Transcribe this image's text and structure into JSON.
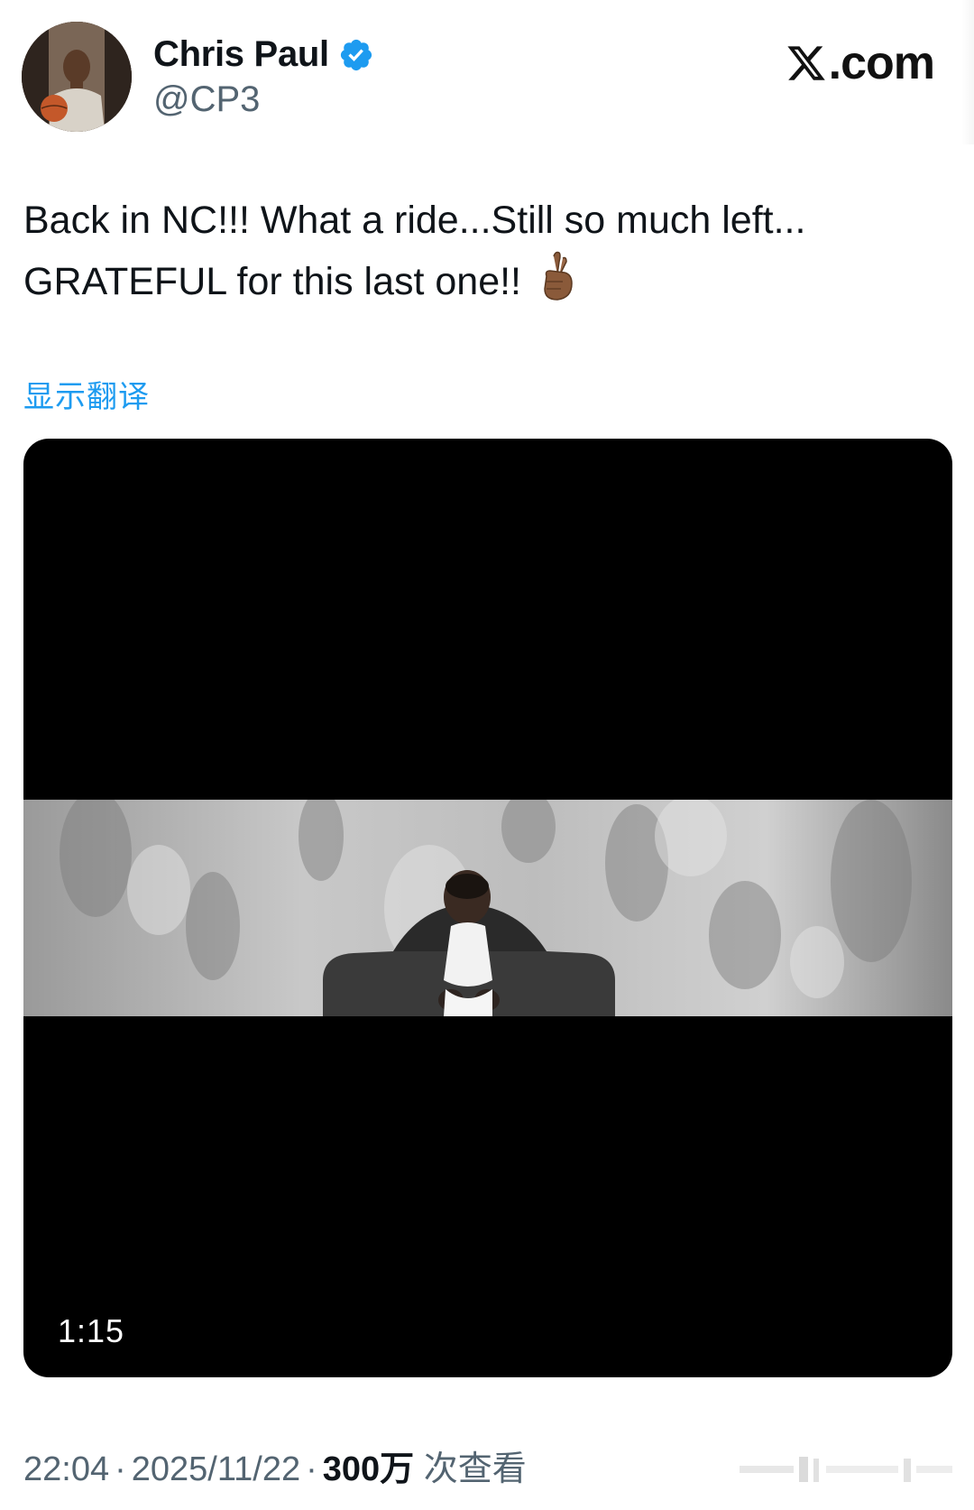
{
  "author": {
    "display_name": "Chris Paul",
    "handle": "@CP3",
    "verified": true
  },
  "brand": {
    "site": ".com",
    "logo_letter": "X"
  },
  "tweet": {
    "line1": "Back in NC!!! What a ride...Still so much left...",
    "line2": "GRATEFUL for this last one!!",
    "emoji": "crossed-fingers-dark-skin-tone",
    "translate_label": "显示翻译"
  },
  "media": {
    "type": "video",
    "duration": "1:15"
  },
  "meta": {
    "time": "22:04",
    "date": "2025/11/22",
    "views_count": "300万",
    "views_label": "次查看",
    "separator": "·"
  },
  "colors": {
    "link": "#1d9bf0",
    "verified": "#1d9bf0",
    "secondary_text": "#536471",
    "primary_text": "#0f1419"
  }
}
